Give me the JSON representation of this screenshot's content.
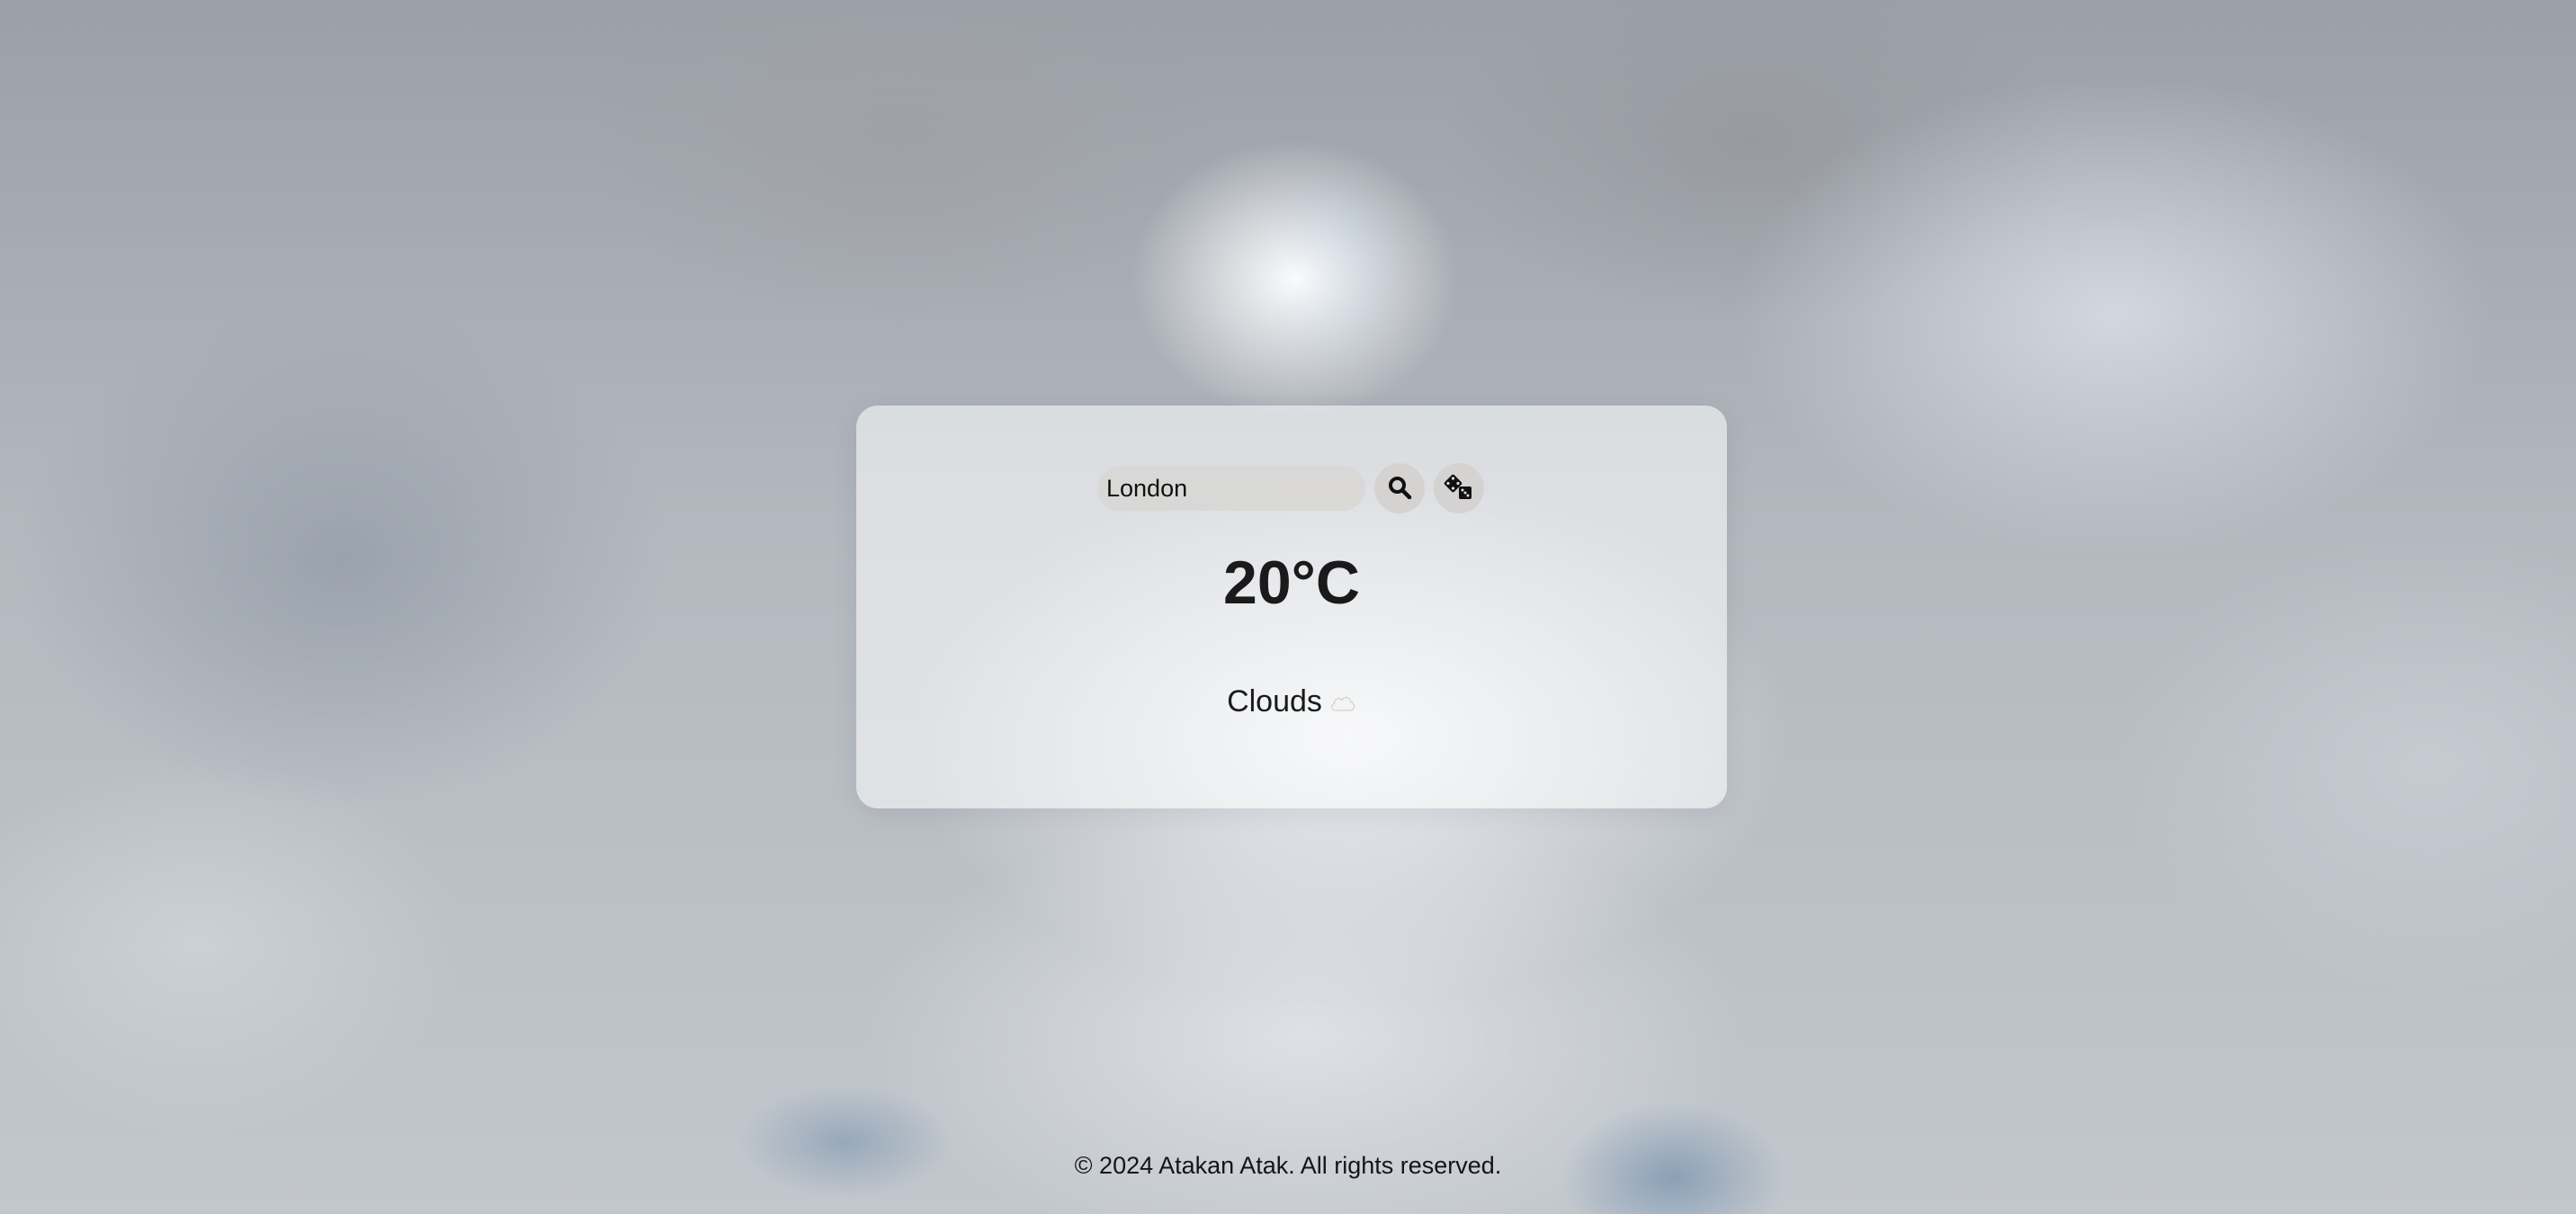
{
  "search": {
    "value": "London",
    "search_icon": "search-icon",
    "random_icon": "dice-icon"
  },
  "weather": {
    "temperature": "20°C",
    "condition": "Clouds",
    "condition_icon": "cloud-icon"
  },
  "footer": {
    "text": "© 2024 Atakan Atak. All rights reserved."
  }
}
